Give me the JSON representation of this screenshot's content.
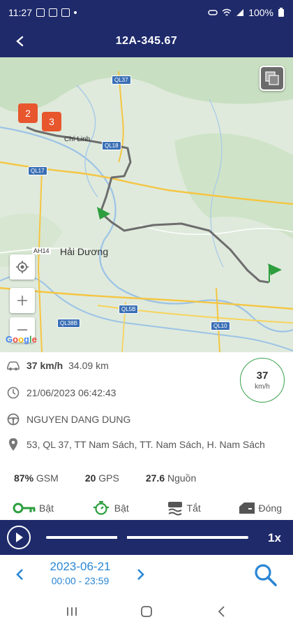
{
  "status_bar": {
    "time": "11:27",
    "battery": "100%"
  },
  "header": {
    "title": "12A-345.67",
    "back_icon": "back-arrow-icon"
  },
  "map": {
    "route_labels": [
      "QL37",
      "QL18",
      "QL17",
      "QL5B",
      "QL38B",
      "QL10"
    ],
    "places": [
      "Chí Linh",
      "Hải Dương",
      "AH14"
    ],
    "clusters": [
      "2",
      "3"
    ],
    "google": "Google",
    "colors": {
      "route": "#6d6d6d",
      "start_flag": "#2e9e3f",
      "cluster": "#e8562e"
    }
  },
  "info": {
    "speed": "37 km/h",
    "distance": "34.09 km",
    "datetime": "21/06/2023 06:42:43",
    "driver": "NGUYEN DANG DUNG",
    "address": "53, QL 37,  TT Nam Sách, TT. Nam Sách, H. Nam Sách",
    "speed_circle_value": "37",
    "speed_circle_unit": "km/h"
  },
  "stats": {
    "gsm_value": "87%",
    "gsm_label": "GSM",
    "gps_value": "20",
    "gps_label": "GPS",
    "power_value": "27.6",
    "power_label": "Nguồn"
  },
  "states": [
    {
      "label": "Bật",
      "icon": "key-icon"
    },
    {
      "label": "Bật",
      "icon": "engine-icon"
    },
    {
      "label": "Tắt",
      "icon": "air-conditioner-icon"
    },
    {
      "label": "Đóng",
      "icon": "door-icon"
    }
  ],
  "player": {
    "speed_multiplier": "1x",
    "progress": 0.35
  },
  "datebar": {
    "date": "2023-06-21",
    "time_range": "00:00 - 23:59"
  }
}
